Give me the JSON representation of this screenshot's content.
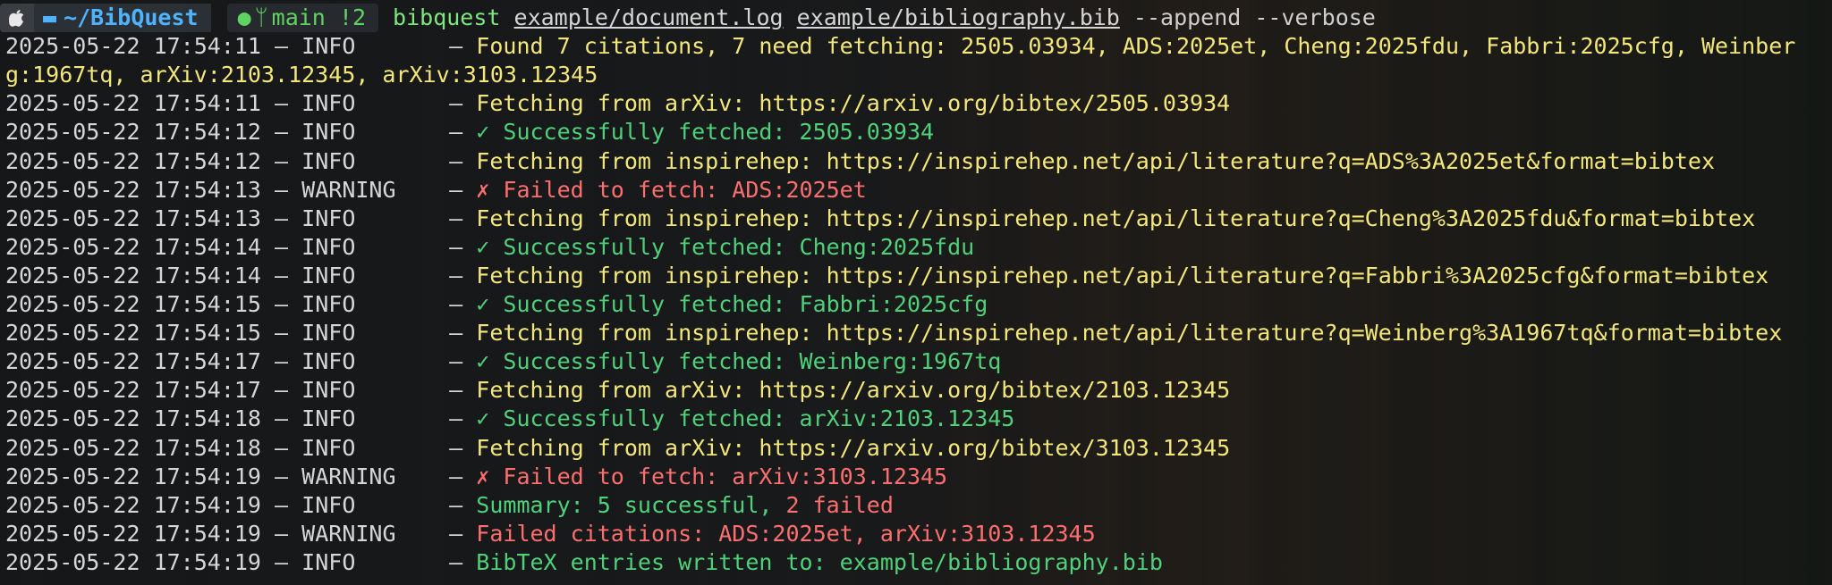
{
  "prompt": {
    "directory": "~/BibQuest",
    "git_branch": "main",
    "git_status": "!2",
    "command": "bibquest",
    "arg1": "example/document.log",
    "arg2": "example/bibliography.bib",
    "flags": "--append --verbose"
  },
  "separator": "–",
  "log": [
    {
      "ts": "2025-05-22 17:54:11",
      "level": "INFO",
      "msg": "Found 7 citations, 7 need fetching: 2505.03934, ADS:2025et, Cheng:2025fdu, Fabbri:2025cfg, Weinber",
      "msg2": "g:1967tq, arXiv:2103.12345, arXiv:3103.12345",
      "color": "y"
    },
    {
      "ts": "2025-05-22 17:54:11",
      "level": "INFO",
      "msg": "Fetching from arXiv: https://arxiv.org/bibtex/2505.03934",
      "color": "y"
    },
    {
      "ts": "2025-05-22 17:54:12",
      "level": "INFO",
      "msg": "✓ Successfully fetched: 2505.03934",
      "color": "g"
    },
    {
      "ts": "2025-05-22 17:54:12",
      "level": "INFO",
      "msg": "Fetching from inspirehep: https://inspirehep.net/api/literature?q=ADS%3A2025et&format=bibtex",
      "color": "y"
    },
    {
      "ts": "2025-05-22 17:54:13",
      "level": "WARNING",
      "msg": "✗ Failed to fetch: ADS:2025et",
      "color": "r"
    },
    {
      "ts": "2025-05-22 17:54:13",
      "level": "INFO",
      "msg": "Fetching from inspirehep: https://inspirehep.net/api/literature?q=Cheng%3A2025fdu&format=bibtex",
      "color": "y"
    },
    {
      "ts": "2025-05-22 17:54:14",
      "level": "INFO",
      "msg": "✓ Successfully fetched: Cheng:2025fdu",
      "color": "g"
    },
    {
      "ts": "2025-05-22 17:54:14",
      "level": "INFO",
      "msg": "Fetching from inspirehep: https://inspirehep.net/api/literature?q=Fabbri%3A2025cfg&format=bibtex",
      "color": "y"
    },
    {
      "ts": "2025-05-22 17:54:15",
      "level": "INFO",
      "msg": "✓ Successfully fetched: Fabbri:2025cfg",
      "color": "g"
    },
    {
      "ts": "2025-05-22 17:54:15",
      "level": "INFO",
      "msg": "Fetching from inspirehep: https://inspirehep.net/api/literature?q=Weinberg%3A1967tq&format=bibtex",
      "color": "y"
    },
    {
      "ts": "2025-05-22 17:54:17",
      "level": "INFO",
      "msg": "✓ Successfully fetched: Weinberg:1967tq",
      "color": "g"
    },
    {
      "ts": "2025-05-22 17:54:17",
      "level": "INFO",
      "msg": "Fetching from arXiv: https://arxiv.org/bibtex/2103.12345",
      "color": "y"
    },
    {
      "ts": "2025-05-22 17:54:18",
      "level": "INFO",
      "msg": "✓ Successfully fetched: arXiv:2103.12345",
      "color": "g"
    },
    {
      "ts": "2025-05-22 17:54:18",
      "level": "INFO",
      "msg": "Fetching from arXiv: https://arxiv.org/bibtex/3103.12345",
      "color": "y"
    },
    {
      "ts": "2025-05-22 17:54:19",
      "level": "WARNING",
      "msg": "✗ Failed to fetch: arXiv:3103.12345",
      "color": "r"
    },
    {
      "ts": "2025-05-22 17:54:19",
      "level": "INFO",
      "msg": "Summary: 5 successful,",
      "msg_extra": " 2 failed",
      "color": "g",
      "extra_color": "r"
    },
    {
      "ts": "2025-05-22 17:54:19",
      "level": "WARNING",
      "msg": "Failed citations: ADS:2025et, arXiv:3103.12345",
      "color": "r"
    },
    {
      "ts": "2025-05-22 17:54:19",
      "level": "INFO",
      "msg": "BibTeX entries written to: example/bibliography.bib",
      "color": "g"
    }
  ],
  "colors": {
    "info_yellow": "#f4e77a",
    "success_green": "#4fd17a",
    "error_red": "#ff6f6f",
    "dir_blue": "#4fb4ff"
  }
}
